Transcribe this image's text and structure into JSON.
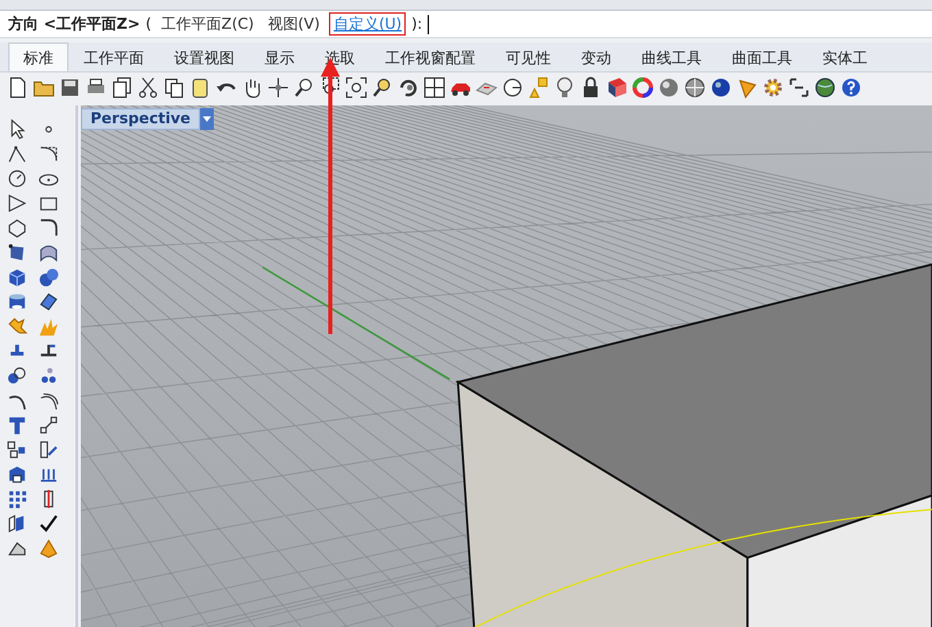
{
  "command_line": {
    "prompt": "方向 <工作平面Z>",
    "open": "(",
    "options": [
      {
        "label": "工作平面Z(C)",
        "kind": "option",
        "highlighted": false
      },
      {
        "label": "视图(V)",
        "kind": "option",
        "highlighted": false
      },
      {
        "label": "自定义(U)",
        "kind": "link",
        "highlighted": true
      }
    ],
    "close": "):"
  },
  "tabs": [
    {
      "label": "标准",
      "selected": true
    },
    {
      "label": "工作平面",
      "selected": false
    },
    {
      "label": "设置视图",
      "selected": false
    },
    {
      "label": "显示",
      "selected": false
    },
    {
      "label": "选取",
      "selected": false
    },
    {
      "label": "工作视窗配置",
      "selected": false
    },
    {
      "label": "可见性",
      "selected": false
    },
    {
      "label": "变动",
      "selected": false
    },
    {
      "label": "曲线工具",
      "selected": false
    },
    {
      "label": "曲面工具",
      "selected": false
    },
    {
      "label": "实体工",
      "selected": false
    }
  ],
  "viewport": {
    "title": "Perspective"
  }
}
